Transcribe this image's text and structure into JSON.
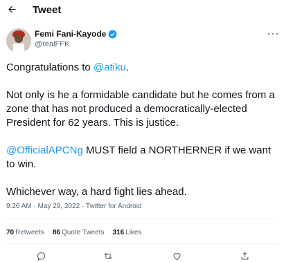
{
  "header": {
    "title": "Tweet",
    "back_icon": "arrow-left-icon"
  },
  "author": {
    "display_name": "Femi Fani-Kayode",
    "handle": "@realFFK",
    "verified_icon": "verified-badge-icon",
    "verified_color": "#1d9bf0"
  },
  "tweet": {
    "line1_prefix": "Congratulations to ",
    "line1_mention": "@atiku",
    "line1_suffix": ".",
    "para2": "Not only is he a formidable candidate but he comes from a zone that has not produced a democratically-elected President for 62 years. This is justice.",
    "para3_mention": "@OfficialAPCNg",
    "para3_text": " MUST field a NORTHERNER if we want to win.",
    "para4": "Whichever way, a hard fight lies ahead."
  },
  "meta": {
    "time": "9:26 AM",
    "sep1": " · ",
    "date": "May 29, 2022",
    "sep2": " · ",
    "source": "Twitter for Android"
  },
  "stats": [
    {
      "count": "70",
      "label": "Retweets"
    },
    {
      "count": "86",
      "label": "Quote Tweets"
    },
    {
      "count": "316",
      "label": "Likes"
    }
  ],
  "actions": [
    "reply-icon",
    "retweet-icon",
    "like-icon",
    "share-icon"
  ],
  "colors": {
    "accent": "#1d9bf0",
    "text": "#0f1419",
    "secondary": "#536471"
  }
}
